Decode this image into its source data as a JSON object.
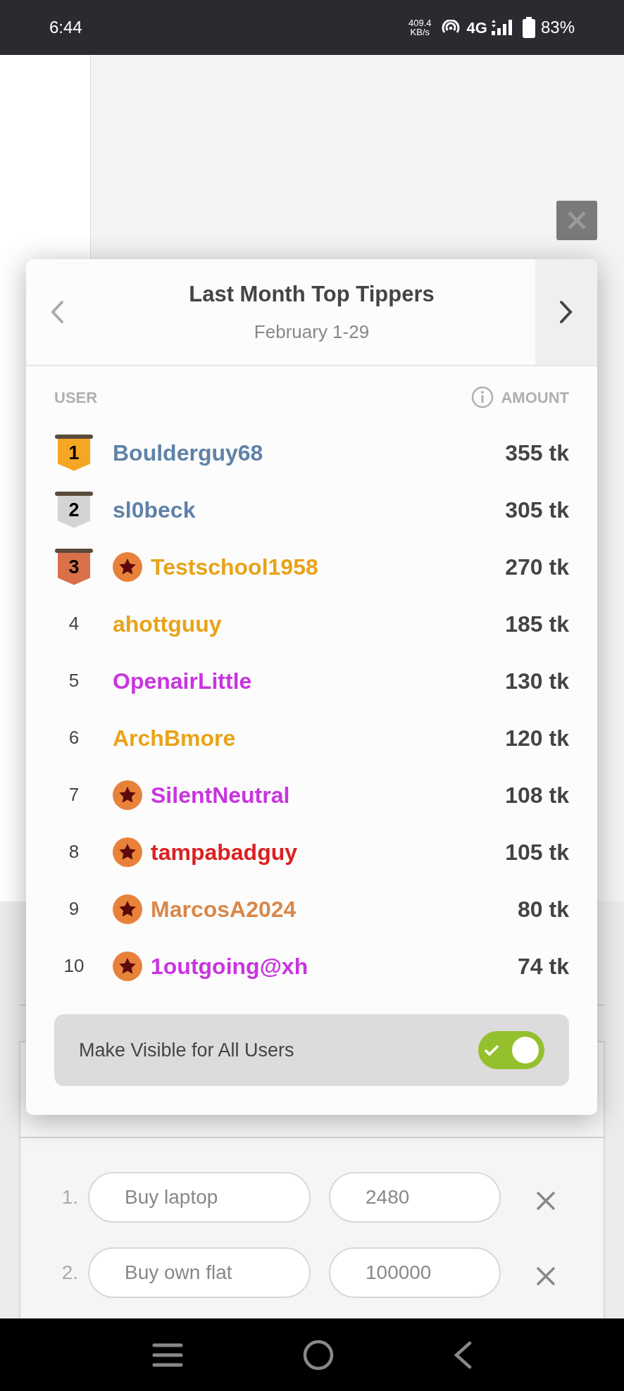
{
  "status_bar": {
    "time": "6:44",
    "speed": "409.4",
    "speed_unit": "KB/s",
    "network": "4G",
    "battery": "83%"
  },
  "background": {
    "goals": [
      {
        "number": "1.",
        "name": "Buy laptop",
        "amount": "2480"
      },
      {
        "number": "2.",
        "name": "Buy own flat",
        "amount": "100000"
      }
    ]
  },
  "modal": {
    "title": "Last Month Top Tippers",
    "subtitle": "February 1-29",
    "columns": [
      "USER",
      "AMOUNT"
    ],
    "rows": [
      {
        "rank": "1",
        "kind": "medal",
        "medal": {
          "color": "#f5a623"
        },
        "star": false,
        "name": "Boulderguy68",
        "color": "#5f82a8",
        "amount": "355 tk"
      },
      {
        "rank": "2",
        "kind": "medal",
        "medal": {
          "color": "#d4d4d4"
        },
        "star": false,
        "name": "sl0beck",
        "color": "#5f82a8",
        "amount": "305 tk"
      },
      {
        "rank": "3",
        "kind": "medal",
        "medal": {
          "color": "#d9704a"
        },
        "star": true,
        "name": "Testschool1958",
        "color": "#e8a317",
        "amount": "270 tk"
      },
      {
        "rank": "4",
        "kind": "plain",
        "star": false,
        "name": "ahottguuy",
        "color": "#e8a317",
        "amount": "185 tk"
      },
      {
        "rank": "5",
        "kind": "plain",
        "star": false,
        "name": "OpenairLittle",
        "color": "#c934e0",
        "amount": "130 tk"
      },
      {
        "rank": "6",
        "kind": "plain",
        "star": false,
        "name": "ArchBmore",
        "color": "#e8a317",
        "amount": "120 tk"
      },
      {
        "rank": "7",
        "kind": "plain",
        "star": true,
        "name": "SilentNeutral",
        "color": "#c934e0",
        "amount": "108 tk"
      },
      {
        "rank": "8",
        "kind": "plain",
        "star": true,
        "name": "tampabadguy",
        "color": "#dc2020",
        "amount": "105 tk"
      },
      {
        "rank": "9",
        "kind": "plain",
        "star": true,
        "name": "MarcosA2024",
        "color": "#d9874a",
        "amount": "80 tk"
      },
      {
        "rank": "10",
        "kind": "plain",
        "star": true,
        "name": "1outgoing@xh",
        "color": "#c934e0",
        "amount": "74 tk"
      }
    ],
    "visibility": {
      "label": "Make Visible for All Users",
      "on": true
    }
  }
}
